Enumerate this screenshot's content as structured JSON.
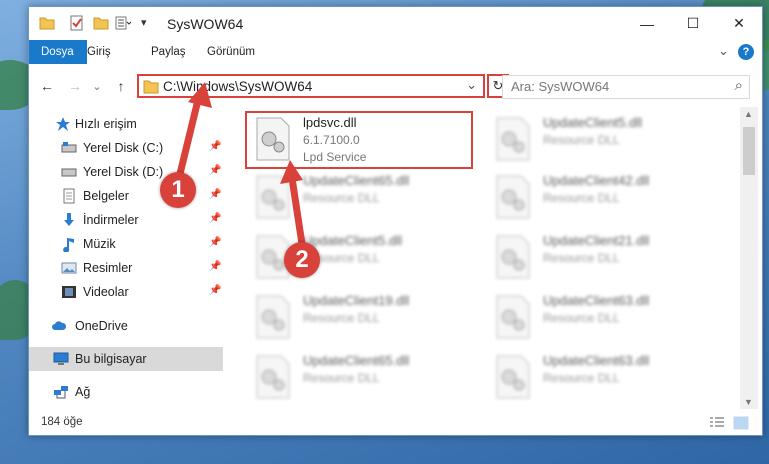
{
  "window": {
    "title": "SysWOW64",
    "minimize": "—",
    "maximize": "☐",
    "close": "✕"
  },
  "ribbon": {
    "tabs": [
      "Dosya",
      "Giriş",
      "Paylaş",
      "Görünüm"
    ],
    "expand": "⌄",
    "help": "?"
  },
  "address": {
    "back": "←",
    "forward": "→",
    "recent": "⌄",
    "up": "↑",
    "path": "C:\\Windows\\SysWOW64",
    "dropdown": "⌄",
    "refresh": "↻",
    "search_placeholder": "Ara: SysWOW64",
    "search_icon": "⌕"
  },
  "nav": {
    "items": [
      {
        "label": "Hızlı erişim",
        "icon": "star-icon"
      },
      {
        "label": "Yerel Disk (C:)",
        "icon": "drive-icon"
      },
      {
        "label": "Yerel Disk (D:)",
        "icon": "drive-icon"
      },
      {
        "label": "Belgeler",
        "icon": "documents-icon"
      },
      {
        "label": "İndirmeler",
        "icon": "download-icon"
      },
      {
        "label": "Müzik",
        "icon": "music-icon"
      },
      {
        "label": "Resimler",
        "icon": "pictures-icon"
      },
      {
        "label": "Videolar",
        "icon": "video-icon"
      },
      {
        "label": "OneDrive",
        "icon": "cloud-icon"
      },
      {
        "label": "Bu bilgisayar",
        "icon": "computer-icon"
      },
      {
        "label": "Ağ",
        "icon": "network-icon"
      }
    ]
  },
  "files": [
    {
      "name": "lpdsvc.dll",
      "line1": "6.1.7100.0",
      "line2": "Lpd Service"
    },
    {
      "name": "UpdateClient5.dll",
      "line1": "Resource DLL"
    },
    {
      "name": "UpdateClient65.dll",
      "line1": "Resource DLL"
    },
    {
      "name": "UpdateClient42.dll",
      "line1": "Resource DLL"
    },
    {
      "name": "UpdateClient5.dll",
      "line1": "Resource DLL"
    },
    {
      "name": "UpdateClient21.dll",
      "line1": "Resource DLL"
    },
    {
      "name": "UpdateClient19.dll",
      "line1": "Resource DLL"
    },
    {
      "name": "UpdateClient63.dll",
      "line1": "Resource DLL"
    },
    {
      "name": "UpdateClient65.dll",
      "line1": "Resource DLL"
    },
    {
      "name": "UpdateClient63.dll",
      "line1": "Resource DLL"
    }
  ],
  "status": {
    "count": "184 öğe"
  },
  "callouts": [
    "1",
    "2"
  ],
  "colors": {
    "accent": "#1979ca",
    "highlight": "#d9413b"
  }
}
